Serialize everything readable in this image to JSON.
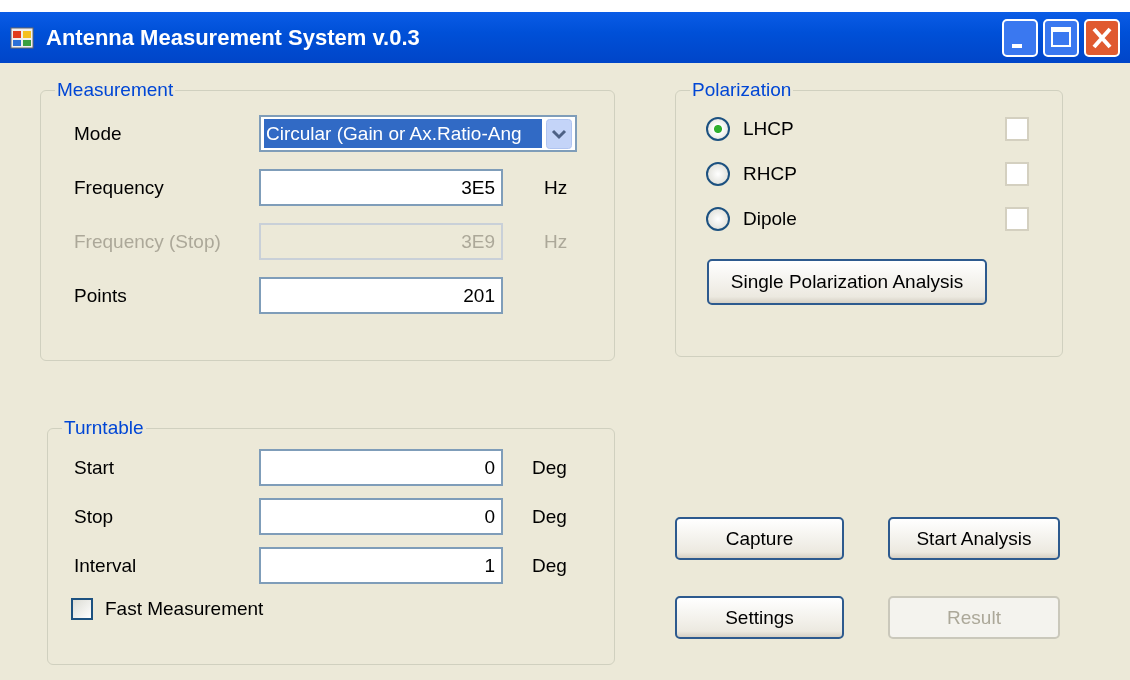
{
  "window": {
    "title": "Antenna Measurement System v.0.3"
  },
  "measurement": {
    "title": "Measurement",
    "fields": [
      {
        "kind": "select",
        "label": "Mode",
        "value": "Circular (Gain or Ax.Ratio-Ang",
        "highlighted": true,
        "disabled": false
      },
      {
        "kind": "text",
        "label": "Frequency",
        "value": "3E5",
        "unit": "Hz",
        "disabled": false
      },
      {
        "kind": "text",
        "label": "Frequency (Stop)",
        "value": "3E9",
        "unit": "Hz",
        "disabled": true
      },
      {
        "kind": "text",
        "label": "Points",
        "value": "201",
        "disabled": false
      }
    ]
  },
  "polarization": {
    "title": "Polarization",
    "options": [
      {
        "label": "LHCP",
        "selected": true,
        "checked": false
      },
      {
        "label": "RHCP",
        "selected": false,
        "checked": false
      },
      {
        "label": "Dipole",
        "selected": false,
        "checked": false
      }
    ],
    "button": "Single Polarization Analysis"
  },
  "turntable": {
    "title": "Turntable",
    "fields": [
      {
        "kind": "text",
        "label": "Start",
        "value": "0",
        "unit": "Deg",
        "disabled": false
      },
      {
        "kind": "text",
        "label": "Stop",
        "value": "0",
        "unit": "Deg",
        "disabled": false
      },
      {
        "kind": "text",
        "label": "Interval",
        "value": "1",
        "unit": "Deg",
        "disabled": false
      }
    ],
    "checkbox": {
      "label": "Fast Measurement",
      "checked": false
    }
  },
  "buttons": [
    {
      "label": "Capture",
      "disabled": false
    },
    {
      "label": "Start Analysis",
      "disabled": false
    },
    {
      "label": "Settings",
      "disabled": false
    },
    {
      "label": "Result",
      "disabled": true
    }
  ]
}
